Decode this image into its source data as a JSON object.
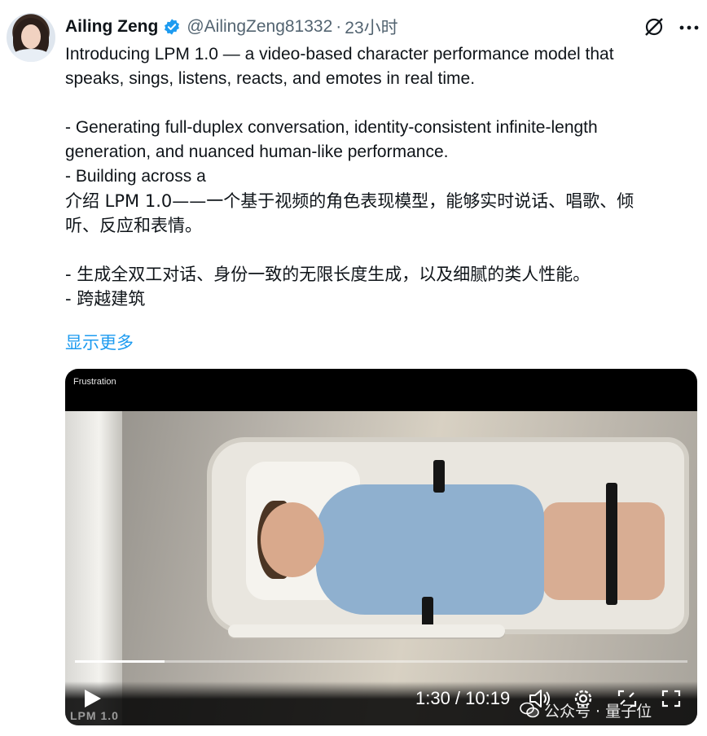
{
  "author": {
    "name": "Ailing Zeng",
    "handle": "@AilingZeng81332",
    "separator": "·",
    "time": "23小时"
  },
  "tweet": {
    "en_lines": [
      "Introducing LPM 1.0 — a video-based character performance model that",
      "speaks, sings, listens, reacts, and emotes in real time.",
      "- Generating full-duplex conversation, identity-consistent infinite-length",
      "generation, and nuanced human-like performance.",
      "- Building across a"
    ],
    "cn_lines": [
      "介绍 LPM 1.0——一个基于视频的角色表现模型，能够实时说话、唱歌、倾",
      "听、反应和表情。",
      "- 生成全双工对话、身份一致的无限长度生成，以及细腻的类人性能。",
      "- 跨越建筑"
    ],
    "show_more": "显示更多"
  },
  "video": {
    "label": "Frustration",
    "timecode": "1:30 / 10:19",
    "progress": 0.146,
    "watermark_text": "LPM 1.0"
  },
  "overlay": {
    "wechat_text": "公众号 · 量子位"
  },
  "icons": [
    "verified-badge-icon",
    "grok-icon",
    "more-icon",
    "play-icon",
    "volume-icon",
    "settings-gear-icon",
    "captions-icon",
    "fullscreen-icon",
    "wechat-logo-icon"
  ],
  "colors": {
    "link": "#1d9bf0",
    "verified": "#1d9bf0",
    "muted": "#536471"
  }
}
